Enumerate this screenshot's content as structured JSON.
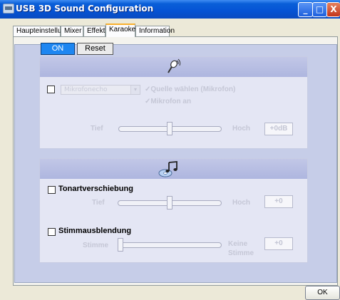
{
  "window": {
    "title": "USB 3D Sound Configuration",
    "controls": {
      "minimize": "_",
      "maximize": "□",
      "close": "X"
    }
  },
  "tabs": [
    {
      "label": "Haupteinstellung",
      "active": false
    },
    {
      "label": "Mixer",
      "active": false
    },
    {
      "label": "Effekt",
      "active": false
    },
    {
      "label": "Karaoke",
      "active": true
    },
    {
      "label": "Information",
      "active": false
    }
  ],
  "buttons": {
    "on": "ON",
    "reset": "Reset",
    "ok": "OK"
  },
  "mic_section": {
    "icon": "microphone-icon",
    "combo_value": "Mikrofonecho",
    "combo_arrow": "▾",
    "check_mark": "✓",
    "option1": "Quelle wählen (Mikrofon)",
    "option2": "Mikrofon an",
    "slider_left": "Tief",
    "slider_right": "Hoch",
    "value": "+0dB",
    "slider_level": 0.5,
    "enabled": false
  },
  "music_section": {
    "icon": "music-disc-icon",
    "key_shift": {
      "label": "Tonartverschiebung",
      "left": "Tief",
      "right": "Hoch",
      "value": "+0",
      "slider_level": 0.5
    },
    "vocal_cancel": {
      "label": "Stimmausblendung",
      "left": "Stimme",
      "right_line1": "Keine",
      "right_line2": "Stimme",
      "value": "+0",
      "slider_level": 0.0
    }
  },
  "colors": {
    "title_bar": "#0553d4",
    "on_button": "#1d86f1",
    "panel_header": "#aeb6df",
    "active_tab_accent": "#f9b02c"
  }
}
